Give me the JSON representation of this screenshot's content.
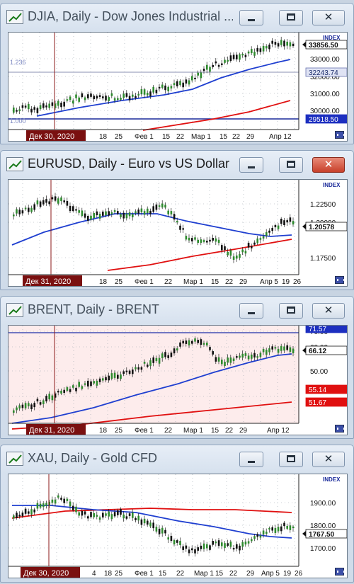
{
  "windows": [
    {
      "id": "djia",
      "title": "DJIA, Daily - Dow Jones Industrial ...",
      "active": false,
      "background": "#ffffff",
      "index_label": "INDEX",
      "price_ticks": [
        "33000.00",
        "32000.00",
        "31000.00",
        "30000.00"
      ],
      "price_markers": [
        {
          "text": "33856.50",
          "style": "current"
        },
        {
          "text": "32243.74",
          "style": "level"
        },
        {
          "text": "29518.50",
          "style": "blue"
        }
      ],
      "level_labels": [
        "1.236",
        "1.000"
      ],
      "date_ticks": [
        "18",
        "25",
        "Фев 1",
        "15",
        "22",
        "Мар 1",
        "15",
        "22",
        "29",
        "Апр 12"
      ],
      "cursor_date": "Дек 30, 2020",
      "colors": {
        "up": "#2e8b2e",
        "down": "#111111",
        "ma_fast": "#1f3fd0",
        "ma_slow": "#e01010"
      }
    },
    {
      "id": "eurusd",
      "title": "EURUSD, Daily - Euro vs US Dollar",
      "active": true,
      "background": "#ffffff",
      "index_label": "INDEX",
      "price_ticks": [
        "1.22500",
        "1.20000",
        "1.17500"
      ],
      "price_markers": [
        {
          "text": "1.20578",
          "style": "current"
        }
      ],
      "level_labels": [],
      "date_ticks": [
        "18",
        "25",
        "Фев 1",
        "22",
        "Мар 1",
        "15",
        "22",
        "29",
        "Апр 5",
        "19",
        "26"
      ],
      "cursor_date": "Дек 31, 2020",
      "colors": {
        "up": "#2e8b2e",
        "down": "#111111",
        "ma_fast": "#1f3fd0",
        "ma_slow": "#e01010"
      }
    },
    {
      "id": "brent",
      "title": "BRENT, Daily - BRENT",
      "active": false,
      "background": "#fdecec",
      "index_label": "INDEX",
      "price_ticks": [
        "70.00",
        "60.00",
        "50.00"
      ],
      "price_markers": [
        {
          "text": "71.57",
          "style": "blue"
        },
        {
          "text": "66.12",
          "style": "current"
        },
        {
          "text": "55.14",
          "style": "red"
        },
        {
          "text": "51.67",
          "style": "red"
        }
      ],
      "level_labels": [],
      "date_ticks": [
        "18",
        "25",
        "Фев 1",
        "22",
        "Мар 1",
        "15",
        "22",
        "29",
        "Апр 12"
      ],
      "cursor_date": "Дек 31, 2020",
      "colors": {
        "up": "#2e8b2e",
        "down": "#111111",
        "ma_fast": "#1f3fd0",
        "ma_slow": "#e01010"
      }
    },
    {
      "id": "xau",
      "title": "XAU, Daily - Gold CFD",
      "active": false,
      "background": "#ffffff",
      "index_label": "INDEX",
      "price_ticks": [
        "1900.00",
        "1800.00",
        "1700.00"
      ],
      "price_markers": [
        {
          "text": "1767.50",
          "style": "current"
        }
      ],
      "level_labels": [],
      "date_ticks": [
        "4",
        "18",
        "25",
        "Фев 1",
        "15",
        "22",
        "Мар 1",
        "15",
        "22",
        "29",
        "Апр 5",
        "19",
        "26"
      ],
      "cursor_date": "Дек 30, 2020",
      "colors": {
        "up": "#2e8b2e",
        "down": "#111111",
        "ma_fast": "#1f3fd0",
        "ma_slow": "#e01010"
      }
    }
  ]
}
